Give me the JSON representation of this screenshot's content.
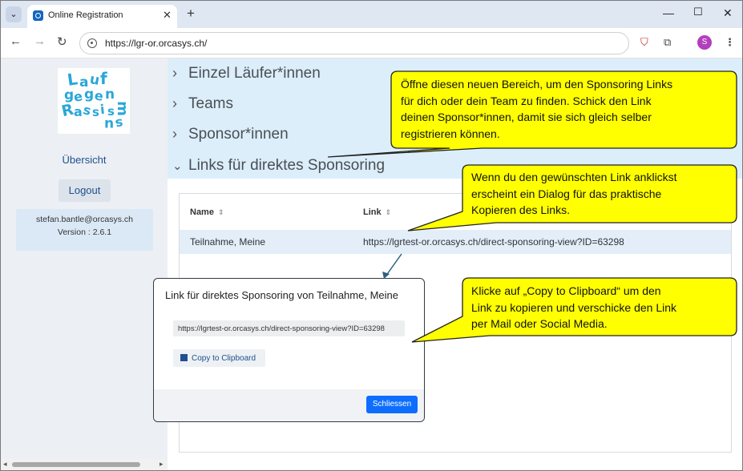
{
  "browser": {
    "tab_title": "Online Registration",
    "url": "https://lgr-or.orcasys.ch/",
    "profile_initial": "S"
  },
  "sidebar": {
    "logo_letters": [
      "L",
      "a",
      "u",
      "f",
      "g",
      "e",
      "g",
      "e",
      "n",
      "R",
      "a",
      "s",
      "s",
      "i",
      "s",
      "m",
      "u",
      "s"
    ],
    "overview_label": "Übersicht",
    "logout_label": "Logout",
    "user_email": "stefan.bantle@orcasys.ch",
    "version": "Version : 2.6.1"
  },
  "accordion": {
    "items": [
      {
        "label": "Einzel Läufer*innen",
        "expanded": false
      },
      {
        "label": "Teams",
        "expanded": false
      },
      {
        "label": "Sponsor*innen",
        "expanded": false
      },
      {
        "label": "Links für direktes Sponsoring",
        "expanded": true
      }
    ]
  },
  "table": {
    "columns": [
      "Name",
      "Link"
    ],
    "rows": [
      {
        "name": "Teilnahme, Meine",
        "link": "https://lgrtest-or.orcasys.ch/direct-sponsoring-view?ID=63298"
      }
    ]
  },
  "dialog": {
    "title": "Link für direktes Sponsoring von Teilnahme, Meine",
    "link_value": "https://lgrtest-or.orcasys.ch/direct-sponsoring-view?ID=63298",
    "copy_label": "Copy to Clipboard",
    "close_label": "Schliessen"
  },
  "callouts": {
    "c1": [
      "Öffne diesen neuen Bereich, um den Sponsoring  Links",
      "für dich oder dein Team zu finden. Schick den Link",
      "deinen Sponsor*innen,  damit sie sich gleich selber",
      "registrieren können."
    ],
    "c2": [
      "Wenn du den gewünschten  Link anklickst",
      "erscheint ein Dialog für das praktische",
      "Kopieren des Links."
    ],
    "c3": [
      "Klicke auf „Copy to Clipboard“ um den",
      "Link zu kopieren und verschicke den Link",
      "per Mail oder Social Media."
    ]
  },
  "colors": {
    "callout_fill": "#ffff00",
    "accordion_band": "#dceefa",
    "primary_button": "#0d6efd"
  }
}
